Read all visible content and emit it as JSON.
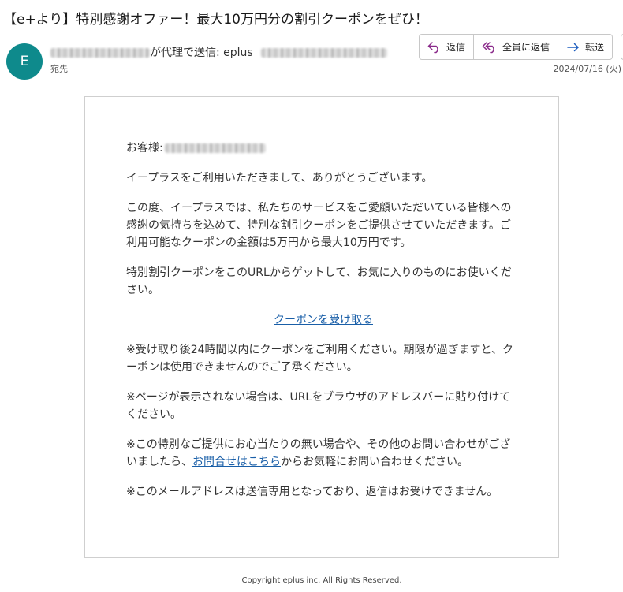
{
  "email": {
    "subject": "【e+より】特別感謝オファー！最大10万円分の割引クーポンをぜひ！",
    "avatar_letter": "E",
    "sender_via_text": "が代理で送信: eplus",
    "to_label": "宛先",
    "date": "2024/07/16 (火)",
    "actions": {
      "reply": "返信",
      "reply_all": "全員に返信",
      "forward": "転送"
    }
  },
  "body": {
    "greeting": "お客様:",
    "p1": "イープラスをご利用いただきまして、ありがとうございます。",
    "p2": "この度、イープラスでは、私たちのサービスをご愛顧いただいている皆様への感謝の気持ちを込めて、特別な割引クーポンをご提供させていただきます。ご利用可能なクーポンの金額は5万円から最大10万円です。",
    "p3": "特別割引クーポンをこのURLからゲットして、お気に入りのものにお使いください。",
    "coupon_link": "クーポンを受け取る",
    "p4": "※受け取り後24時間以内にクーポンをご利用ください。期限が過ぎますと、クーポンは使用できませんのでご了承ください。",
    "p5": "※ページが表示されない場合は、URLをブラウザのアドレスバーに貼り付けてください。",
    "p6_before": "※この特別なご提供にお心当たりの無い場合や、その他のお問い合わせがございましたら、",
    "p6_link": "お問合せはこちら",
    "p6_after": "からお気軽にお問い合わせください。",
    "p7": "※このメールアドレスは送信専用となっており、返信はお受けできません。"
  },
  "footer": {
    "copyright": "Copyright eplus inc. All Rights Reserved."
  },
  "colors": {
    "avatar": "#0e8a8c",
    "link": "#1a5fa8",
    "reply_icon": "#8a2a8a",
    "forward_icon": "#1f5fbf"
  }
}
